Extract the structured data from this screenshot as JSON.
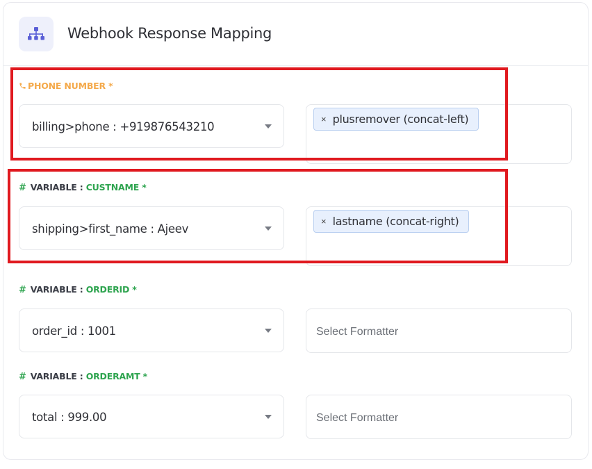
{
  "header": {
    "title": "Webhook Response Mapping",
    "icon": "sitemap-icon",
    "accent": "#5a5fd6"
  },
  "rows": [
    {
      "type": "phone",
      "label": "PHONE NUMBER *",
      "select_value": "billing>phone : +919876543210",
      "formatter_tag": "plusremover (concat-left)"
    },
    {
      "type": "variable",
      "label_prefix": "VARIABLE :",
      "label_name": "CUSTNAME *",
      "select_value": "shipping>first_name : Ajeev",
      "formatter_tag": "lastname (concat-right)"
    },
    {
      "type": "variable",
      "label_prefix": "VARIABLE :",
      "label_name": "ORDERID *",
      "select_value": "order_id : 1001",
      "formatter_placeholder": "Select Formatter"
    },
    {
      "type": "variable",
      "label_prefix": "VARIABLE :",
      "label_name": "ORDERAMT *",
      "select_value": "total : 999.00",
      "formatter_placeholder": "Select Formatter"
    }
  ],
  "symbols": {
    "hash": "#",
    "remove": "×"
  },
  "colors": {
    "phone_label": "#f4a94a",
    "variable_name": "#2ea44f",
    "highlight": "#e0191f",
    "tag_bg": "#e8f0fd"
  }
}
